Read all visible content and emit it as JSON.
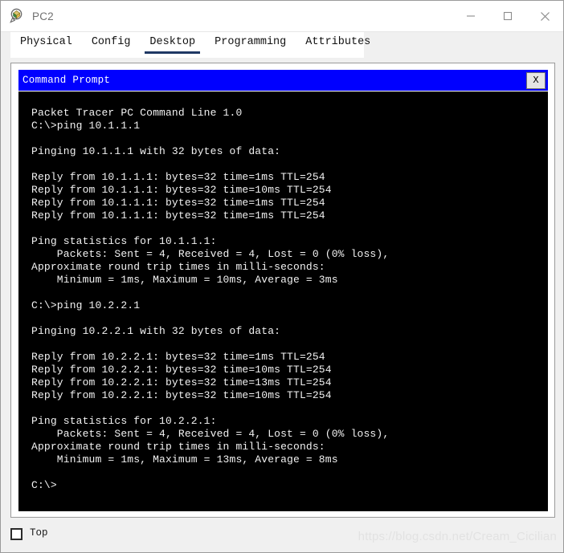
{
  "window": {
    "title": "PC2",
    "icon": "packet-tracer-pc-icon",
    "controls": {
      "minimize": "—",
      "maximize": "□",
      "close": "✕"
    }
  },
  "tabs": [
    {
      "label": "Physical",
      "active": false
    },
    {
      "label": "Config",
      "active": false
    },
    {
      "label": "Desktop",
      "active": true
    },
    {
      "label": "Programming",
      "active": false
    },
    {
      "label": "Attributes",
      "active": false
    }
  ],
  "command_prompt": {
    "title": "Command Prompt",
    "close_label": "X",
    "titlebar_color": "#0000ff",
    "terminal_bg": "#000000",
    "terminal_fg": "#f2f2f2",
    "lines": [
      "Packet Tracer PC Command Line 1.0",
      "C:\\>ping 10.1.1.1",
      "",
      "Pinging 10.1.1.1 with 32 bytes of data:",
      "",
      "Reply from 10.1.1.1: bytes=32 time=1ms TTL=254",
      "Reply from 10.1.1.1: bytes=32 time=10ms TTL=254",
      "Reply from 10.1.1.1: bytes=32 time=1ms TTL=254",
      "Reply from 10.1.1.1: bytes=32 time=1ms TTL=254",
      "",
      "Ping statistics for 10.1.1.1:",
      "    Packets: Sent = 4, Received = 4, Lost = 0 (0% loss),",
      "Approximate round trip times in milli-seconds:",
      "    Minimum = 1ms, Maximum = 10ms, Average = 3ms",
      "",
      "C:\\>ping 10.2.2.1",
      "",
      "Pinging 10.2.2.1 with 32 bytes of data:",
      "",
      "Reply from 10.2.2.1: bytes=32 time=1ms TTL=254",
      "Reply from 10.2.2.1: bytes=32 time=10ms TTL=254",
      "Reply from 10.2.2.1: bytes=32 time=13ms TTL=254",
      "Reply from 10.2.2.1: bytes=32 time=10ms TTL=254",
      "",
      "Ping statistics for 10.2.2.1:",
      "    Packets: Sent = 4, Received = 4, Lost = 0 (0% loss),",
      "Approximate round trip times in milli-seconds:",
      "    Minimum = 1ms, Maximum = 13ms, Average = 8ms",
      "",
      "C:\\>"
    ]
  },
  "footer": {
    "top_label": "Top",
    "top_checked": false,
    "watermark": "https://blog.csdn.net/Cream_Cicilian"
  }
}
